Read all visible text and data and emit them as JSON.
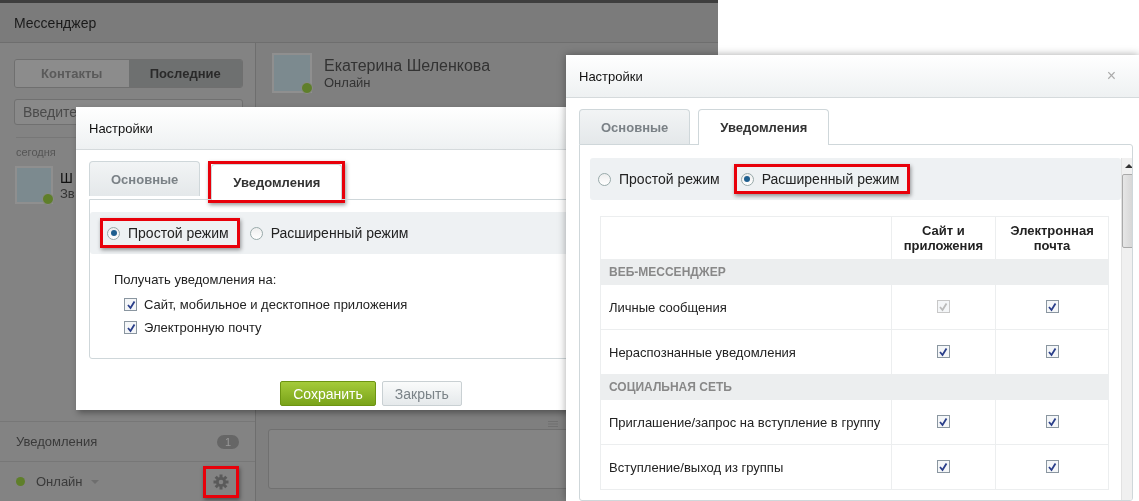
{
  "messenger": {
    "title": "Мессенджер",
    "tabs": [
      {
        "label": "Контакты",
        "selected": false
      },
      {
        "label": "Последние",
        "selected": true
      }
    ],
    "search": {
      "placeholder": "Введите"
    },
    "date_label": "сегодня",
    "recent": [
      {
        "name": "Ш",
        "subtitle": "Зв",
        "online": true
      }
    ],
    "chat": {
      "name": "Екатерина Шеленкова",
      "status": "Онлайн",
      "online": true
    },
    "notifications": {
      "label": "Уведомления",
      "count": "1"
    },
    "status": {
      "label": "Онлайн",
      "color": "#5f7f2a"
    },
    "settings": {
      "highlighted": true
    }
  },
  "settings_dialog": {
    "title": "Настройки",
    "tabs": [
      {
        "label": "Основные",
        "selected": false,
        "highlighted": false
      },
      {
        "label": "Уведомления",
        "selected": true,
        "highlighted": true
      }
    ],
    "modes": [
      {
        "label": "Простой режим",
        "selected": true,
        "highlighted": true
      },
      {
        "label": "Расширенный режим",
        "selected": false,
        "highlighted": false
      }
    ],
    "receive_label": "Получать уведомления на:",
    "options": [
      {
        "label": "Сайт, мобильное и десктопное приложения",
        "checked": true
      },
      {
        "label": "Электронную почту",
        "checked": true
      }
    ],
    "buttons": [
      {
        "label": "Сохранить",
        "kind": "primary"
      },
      {
        "label": "Закрыть",
        "kind": "secondary"
      }
    ]
  },
  "settings_dialog_advanced": {
    "title": "Настройки",
    "close": "×",
    "tabs": [
      {
        "label": "Основные",
        "selected": false,
        "highlighted": false
      },
      {
        "label": "Уведомления",
        "selected": true,
        "highlighted": false
      }
    ],
    "modes": [
      {
        "label": "Простой режим",
        "selected": false,
        "highlighted": false
      },
      {
        "label": "Расширенный режим",
        "selected": true,
        "highlighted": true
      }
    ],
    "columns": [
      "Сайт и приложения",
      "Электронная почта"
    ],
    "rows": [
      {
        "kind": "section",
        "label": "ВЕБ-МЕССЕНДЖЕР"
      },
      {
        "kind": "item",
        "label": "Личные сообщения",
        "site": {
          "checked": true,
          "disabled": true
        },
        "email": {
          "checked": true,
          "disabled": false
        }
      },
      {
        "kind": "item",
        "label": "Нераспознанные уведомления",
        "site": {
          "checked": true,
          "disabled": false
        },
        "email": {
          "checked": true,
          "disabled": false
        }
      },
      {
        "kind": "section",
        "label": "СОЦИАЛЬНАЯ СЕТЬ"
      },
      {
        "kind": "item",
        "label": "Приглашение/запрос на вступление в группу",
        "site": {
          "checked": true,
          "disabled": false
        },
        "email": {
          "checked": true,
          "disabled": false
        }
      },
      {
        "kind": "item",
        "label": "Вступление/выход из группы",
        "site": {
          "checked": true,
          "disabled": false
        },
        "email": {
          "checked": true,
          "disabled": false
        }
      }
    ]
  }
}
